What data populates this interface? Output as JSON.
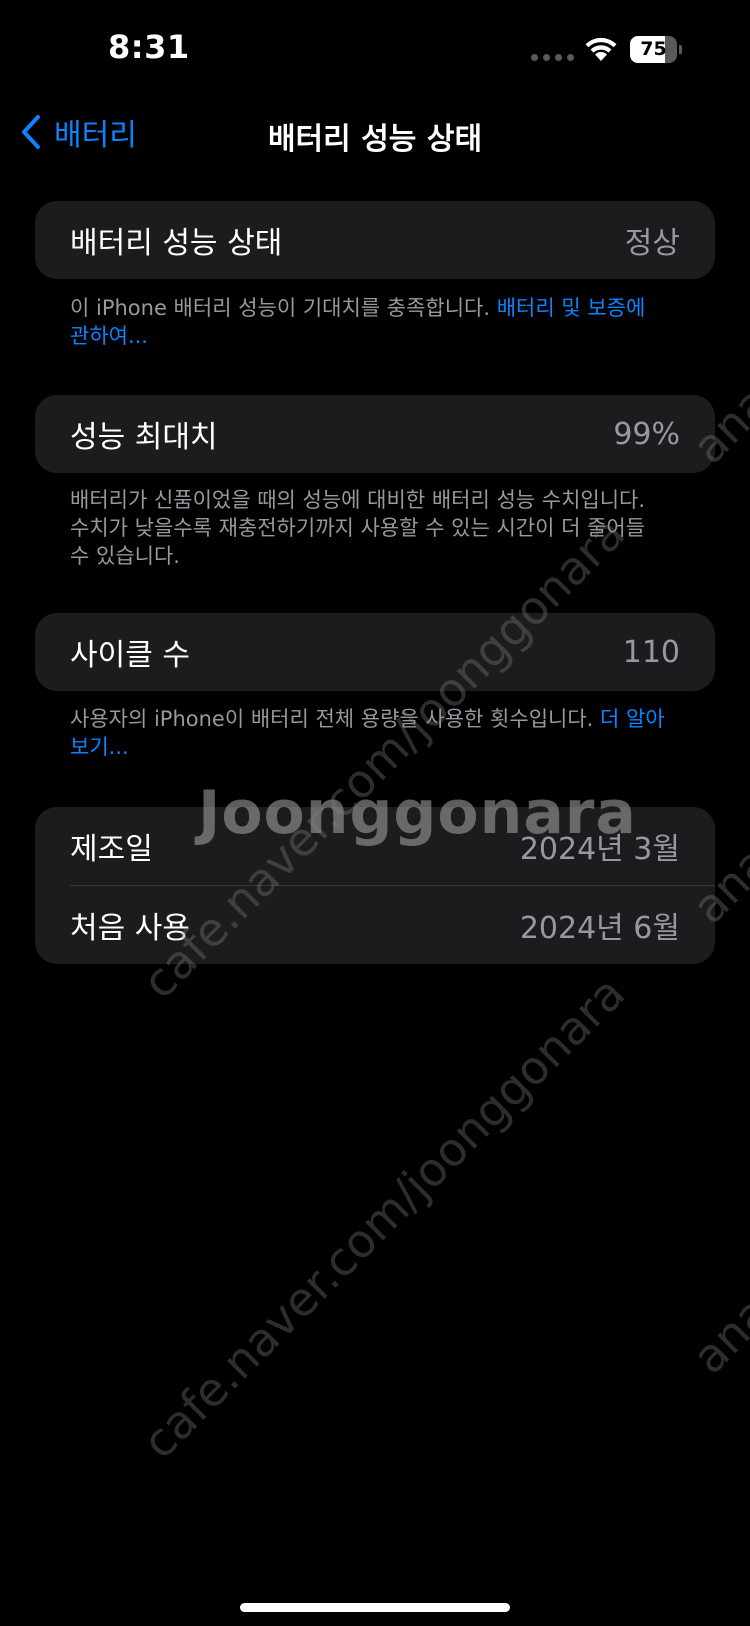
{
  "status": {
    "time": "8:31",
    "battery_percent": "75",
    "battery_level": 0.75
  },
  "nav": {
    "back_label": "배터리",
    "title": "배터리 성능 상태"
  },
  "health": {
    "label": "배터리 성능 상태",
    "value": "정상",
    "note": "이 iPhone 배터리 성능이 기대치를 충족합니다. ",
    "note_link": "배터리 및 보증에 관하여..."
  },
  "max_capacity": {
    "label": "성능 최대치",
    "value": "99%",
    "note": "배터리가 신품이었을 때의 성능에 대비한 배터리 성능 수치입니다. 수치가 낮을수록 재충전하기까지 사용할 수 있는 시간이 더 줄어들 수 있습니다."
  },
  "cycle_count": {
    "label": "사이클 수",
    "value": "110",
    "note": "사용자의 iPhone이 배터리 전체 용량을 사용한 횟수입니다. ",
    "note_link": "더 알아보기..."
  },
  "dates": [
    {
      "label": "제조일",
      "value": "2024년 3월"
    },
    {
      "label": "처음 사용",
      "value": "2024년 6월"
    }
  ],
  "watermark": {
    "text": "cafe.naver.com/joonggonara",
    "side_text": "ana",
    "brand": "Joonggonara"
  }
}
